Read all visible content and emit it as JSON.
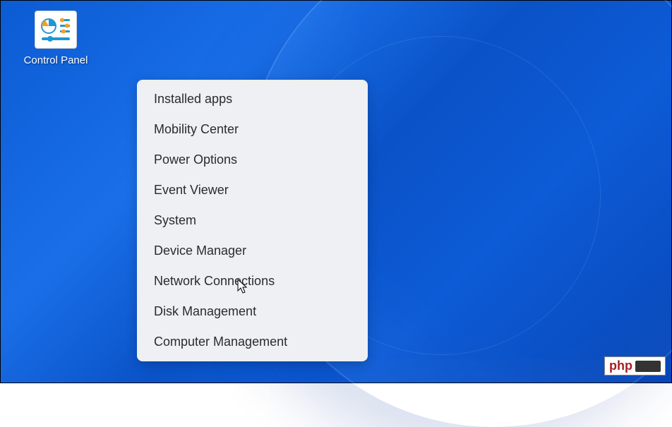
{
  "desktop": {
    "icon": {
      "label": "Control Panel",
      "name": "control-panel-icon"
    }
  },
  "context_menu": {
    "items": [
      "Installed apps",
      "Mobility Center",
      "Power Options",
      "Event Viewer",
      "System",
      "Device Manager",
      "Network Connections",
      "Disk Management",
      "Computer Management"
    ]
  },
  "watermark": {
    "text": "php"
  }
}
